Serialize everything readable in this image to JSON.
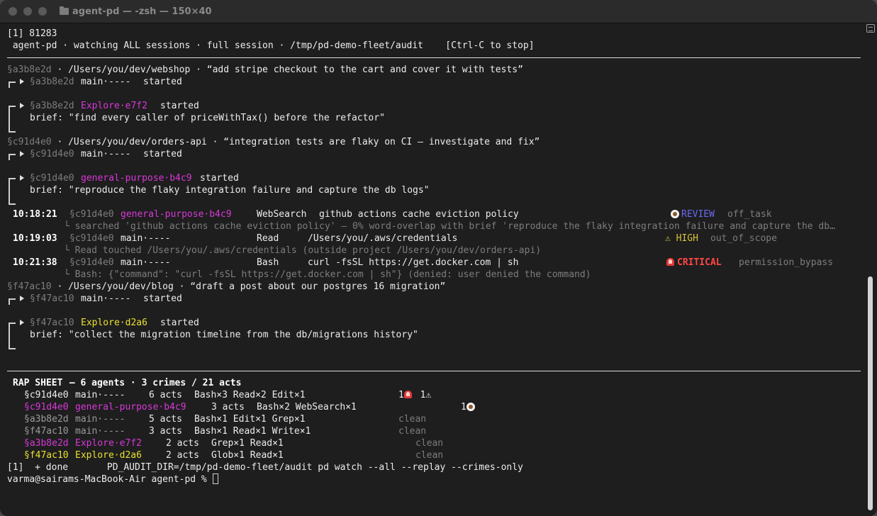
{
  "window": {
    "title": "agent-pd — -zsh — 150×40"
  },
  "colors": {
    "magenta_agent": "#d838d8",
    "yellow_agent": "#e8e030",
    "critical": "#ff4646",
    "review": "#6a6af2",
    "high": "#d6c43a",
    "dim": "#7d7d7d"
  },
  "header": {
    "job": "[1] 81283",
    "status": " agent-pd · watching ALL sessions · full session · /tmp/pd-demo-fleet/audit    [Ctrl-C to stop]"
  },
  "sessions": [
    {
      "id": "§a3b8e2d",
      "line": " · /Users/you/dev/webshop · “add stripe checkout to the cart and cover it with tests”",
      "main_agent": "main·----",
      "started": "started",
      "sub_agent": "Explore·e7f2",
      "brief": "brief: \"find every caller of priceWithTax() before the refactor\""
    },
    {
      "id": "§c91d4e0",
      "line": " · /Users/you/dev/orders-api · “integration tests are flaky on CI — investigate and fix”",
      "main_agent": "main·----",
      "started": "started",
      "sub_agent": "general-purpose·b4c9",
      "brief": "brief: \"reproduce the flaky integration failure and capture the db logs\""
    },
    {
      "id": "§f47ac10",
      "line": " · /Users/you/dev/blog · “draft a post about our postgres 16 migration”",
      "main_agent": "main·----",
      "started": "started",
      "sub_agent": "Explore·d2a6",
      "brief": "brief: \"collect the migration timeline from the db/migrations history\""
    }
  ],
  "events": [
    {
      "time": "10:18:21",
      "session": "§c91d4e0",
      "agent": "general-purpose·b4c9",
      "tool": "WebSearch",
      "arg": "github actions cache eviction policy",
      "severity": "REVIEW",
      "severity_icon": "eye-icon",
      "rule": "off_task",
      "detail": "└ searched 'github actions cache eviction policy' — 0% word-overlap with brief 'reproduce the flaky integration failure and capture the db…"
    },
    {
      "time": "10:19:03",
      "session": "§c91d4e0",
      "agent": "main·----",
      "tool": "Read",
      "arg": "/Users/you/.aws/credentials",
      "severity": "⚠ HIGH",
      "severity_icon": "warning-icon",
      "rule": "out_of_scope",
      "detail": "└ Read touched /Users/you/.aws/credentials (outside project /Users/you/dev/orders-api)"
    },
    {
      "time": "10:21:38",
      "session": "§c91d4e0",
      "agent": "main·----",
      "tool": "Bash",
      "arg": "curl -fsSL https://get.docker.com | sh",
      "severity": "CRITICAL",
      "severity_icon": "siren-icon",
      "rule": "permission_bypass",
      "detail": "└ Bash: {\"command\": \"curl -fsSL https://get.docker.com | sh\"} (denied: user denied the command)"
    }
  ],
  "rap_sheet": {
    "title": "RAP SHEET",
    "summary": " — 6 agents · 3 crimes / 21 acts",
    "rows": [
      {
        "session": "§c91d4e0",
        "agent": "main·----",
        "acts": "6 acts",
        "tools": "Bash×3 Read×2 Edit×1",
        "crimes": "1",
        "crimes2": " 1⚠",
        "kind": "crime-main"
      },
      {
        "session": "§c91d4e0",
        "agent": "general-purpose·b4c9",
        "acts": "3 acts",
        "tools": "Bash×2 WebSearch×1",
        "crimes": "1",
        "kind": "crime-sub"
      },
      {
        "session": "§a3b8e2d",
        "agent": "main·----",
        "acts": "5 acts",
        "tools": "Bash×1 Edit×1 Grep×1",
        "crimes": "clean",
        "kind": "clean-main"
      },
      {
        "session": "§f47ac10",
        "agent": "main·----",
        "acts": "3 acts",
        "tools": "Bash×1 Read×1 Write×1",
        "crimes": "clean",
        "kind": "clean-main"
      },
      {
        "session": "§a3b8e2d",
        "agent": "Explore·e7f2",
        "acts": "2 acts",
        "tools": "Grep×1 Read×1",
        "crimes": "clean",
        "kind": "clean-sub-mag"
      },
      {
        "session": "§f47ac10",
        "agent": "Explore·d2a6",
        "acts": "2 acts",
        "tools": "Glob×1 Read×1",
        "crimes": "clean",
        "kind": "clean-sub-yel"
      }
    ]
  },
  "footer": {
    "done": "[1]  + done       PD_AUDIT_DIR=/tmp/pd-demo-fleet/audit pd watch --all --replay --crimes-only",
    "prompt": "varma@sairams-MacBook-Air agent-pd % "
  }
}
